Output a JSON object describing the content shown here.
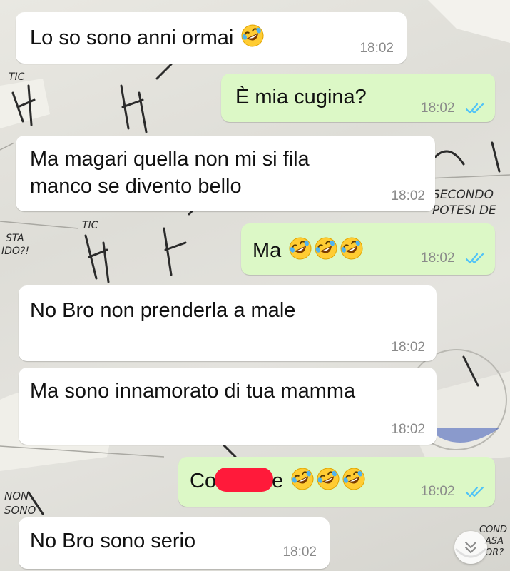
{
  "messages": [
    {
      "text": "Lo so sono anni ormai",
      "emoji_count": 1,
      "time": "18:02",
      "direction": "incoming"
    },
    {
      "text": "È mia cugina?",
      "emoji_count": 0,
      "time": "18:02",
      "direction": "outgoing",
      "status": "read"
    },
    {
      "line1": "Ma magari quella non mi si fila",
      "line2": "manco se divento bello",
      "time": "18:02",
      "direction": "incoming"
    },
    {
      "text": "Ma",
      "emoji_count": 3,
      "time": "18:02",
      "direction": "outgoing",
      "status": "read"
    },
    {
      "text": "No Bro non prenderla a male",
      "time": "18:02",
      "direction": "incoming"
    },
    {
      "text": "Ma sono innamorato di tua mamma",
      "time": "18:02",
      "direction": "incoming"
    },
    {
      "prefix": "Co",
      "suffix": "e",
      "emoji_count": 3,
      "redacted": true,
      "time": "18:02",
      "direction": "outgoing",
      "status": "read"
    },
    {
      "text": "No Bro sono serio",
      "time": "18:02",
      "direction": "incoming"
    }
  ],
  "emoji_name": "rolling-on-the-floor-laughing",
  "background_art": [
    "TIC",
    "STA",
    "IDO?!",
    "SECONDO",
    "POTESI DE",
    "NON",
    "SONO",
    "COND",
    "ASA",
    "OR?"
  ],
  "colors": {
    "incoming_bubble": "#ffffff",
    "outgoing_bubble": "#dcf8c6",
    "read_ticks": "#4fc3f7",
    "timestamp": "#8a8a8a",
    "redaction": "#ff1a3a"
  },
  "scroll_button_icon": "chevron-down-icon"
}
